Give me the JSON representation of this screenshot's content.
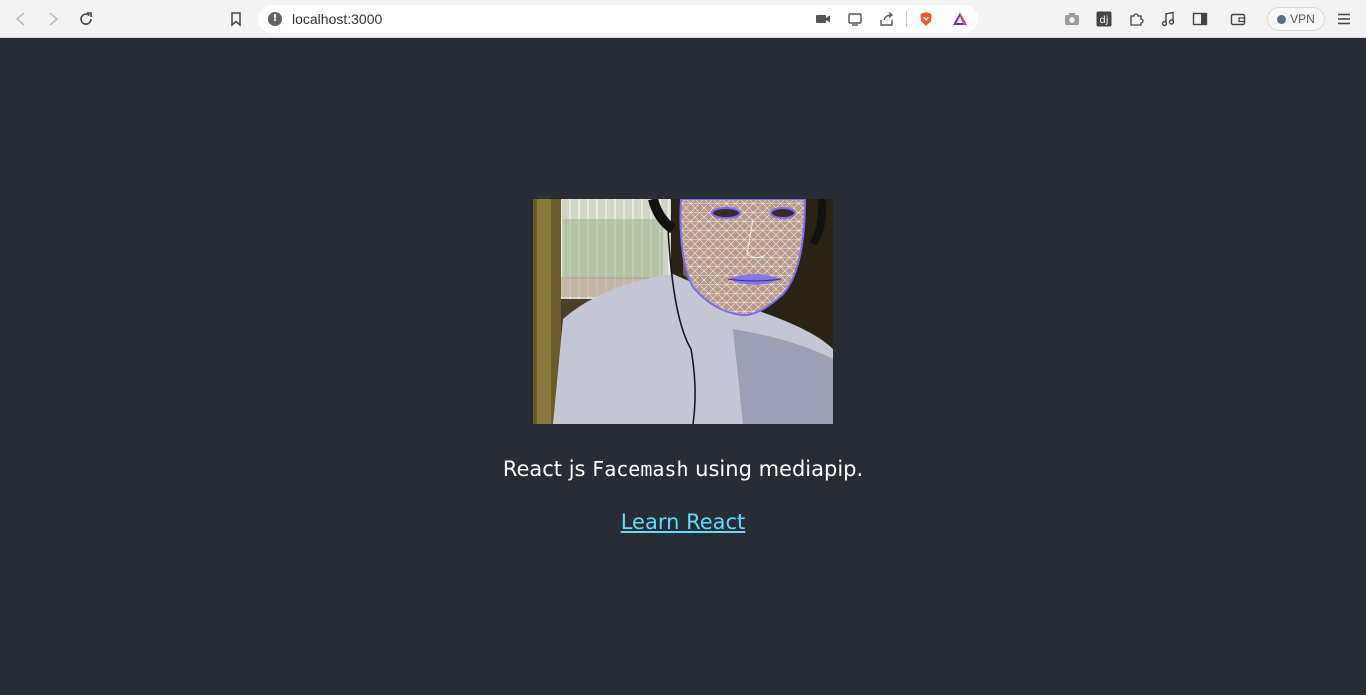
{
  "browser": {
    "url": "localhost:3000",
    "vpn_label": "VPN",
    "icons": {
      "back": "back-arrow-icon",
      "forward": "forward-arrow-icon",
      "reload": "reload-icon",
      "bookmark": "bookmark-icon",
      "site_info": "info-icon",
      "camera": "video-camera-icon",
      "cast": "cast-icon",
      "share": "share-icon",
      "brave": "brave-shield-icon",
      "rewards": "brave-rewards-icon",
      "screenshot": "camera-icon",
      "extension_dj": "dj-extension-icon",
      "extensions": "puzzle-icon",
      "media": "music-note-icon",
      "sidebar": "sidebar-icon",
      "wallet": "wallet-icon",
      "menu": "hamburger-menu-icon"
    }
  },
  "page": {
    "caption_pre": "React js ",
    "caption_code": "Facemash",
    "caption_post": " using mediapip.",
    "link_text": "Learn React",
    "background": "#282c34",
    "link_color": "#61dafb",
    "mesh_color": "#7b6cf0"
  }
}
